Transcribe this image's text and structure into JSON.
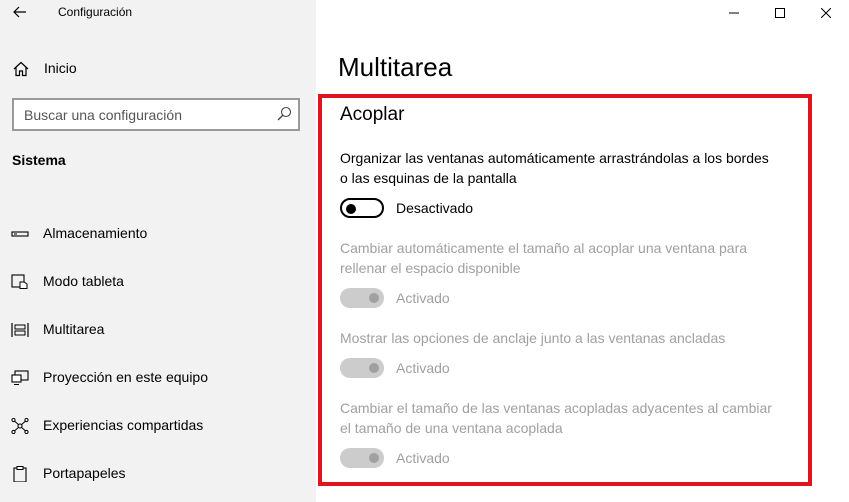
{
  "app": {
    "title": "Configuración"
  },
  "window_controls": {
    "minimize_icon": "minimize-icon",
    "maximize_icon": "maximize-icon",
    "close_icon": "close-icon"
  },
  "sidebar": {
    "home_label": "Inicio",
    "search_placeholder": "Buscar una configuración",
    "section_title": "Sistema",
    "items": [
      {
        "label": "Almacenamiento",
        "icon": "storage-icon"
      },
      {
        "label": "Modo tableta",
        "icon": "tablet-mode-icon"
      },
      {
        "label": "Multitarea",
        "icon": "multitasking-icon"
      },
      {
        "label": "Proyección en este equipo",
        "icon": "projection-icon"
      },
      {
        "label": "Experiencias compartidas",
        "icon": "shared-experiences-icon"
      },
      {
        "label": "Portapapeles",
        "icon": "clipboard-icon"
      }
    ]
  },
  "main": {
    "page_title": "Multitarea",
    "highlight_color": "#e0131f",
    "group_title": "Acoplar",
    "settings": [
      {
        "description": "Organizar las ventanas automáticamente arrastrándolas a los bordes o las esquinas de la pantalla",
        "state_label": "Desactivado",
        "enabled": true,
        "on": false
      },
      {
        "description": "Cambiar automáticamente el tamaño al acoplar una ventana para rellenar el espacio disponible",
        "state_label": "Activado",
        "enabled": false,
        "on": true
      },
      {
        "description": "Mostrar las opciones de anclaje junto a las ventanas ancladas",
        "state_label": "Activado",
        "enabled": false,
        "on": true
      },
      {
        "description": "Cambiar el tamaño de las ventanas acopladas adyacentes al cambiar el tamaño de una ventana acoplada",
        "state_label": "Activado",
        "enabled": false,
        "on": true
      }
    ]
  }
}
